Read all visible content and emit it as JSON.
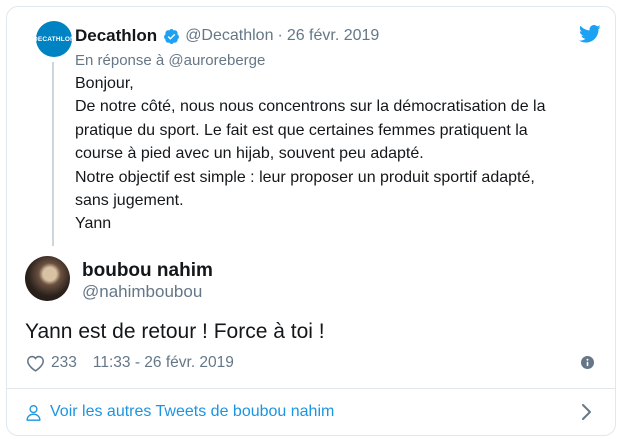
{
  "parent_tweet": {
    "avatar_text": "DECATHLON",
    "name": "Decathlon",
    "handle": "@Decathlon",
    "separator": "·",
    "date": "26 févr. 2019",
    "reply_to": "En réponse à @auroreberge",
    "body_lines": [
      "Bonjour,",
      "De notre côté, nous nous concentrons sur la démocratisation de la",
      "pratique du sport. Le fait est que certaines femmes pratiquent la",
      "course à pied avec un hijab, souvent peu adapté.",
      "Notre objectif est simple : leur proposer un produit sportif adapté,",
      "sans jugement.",
      "Yann"
    ]
  },
  "main_tweet": {
    "name": "boubou nahim",
    "handle": "@nahimboubou",
    "text": "Yann est de retour ! Force à toi !",
    "likes": "233",
    "timestamp": "11:33 - 26 févr. 2019"
  },
  "footer": {
    "more_tweets_label": "Voir les autres Tweets de boubou nahim"
  },
  "colors": {
    "link": "#1b95e0",
    "verified": "#1da1f2",
    "brand": "#0082c3",
    "muted": "#657786"
  },
  "icons": [
    "twitter-bird-icon",
    "verified-badge-icon",
    "heart-icon",
    "info-icon",
    "person-icon",
    "chevron-right-icon"
  ]
}
